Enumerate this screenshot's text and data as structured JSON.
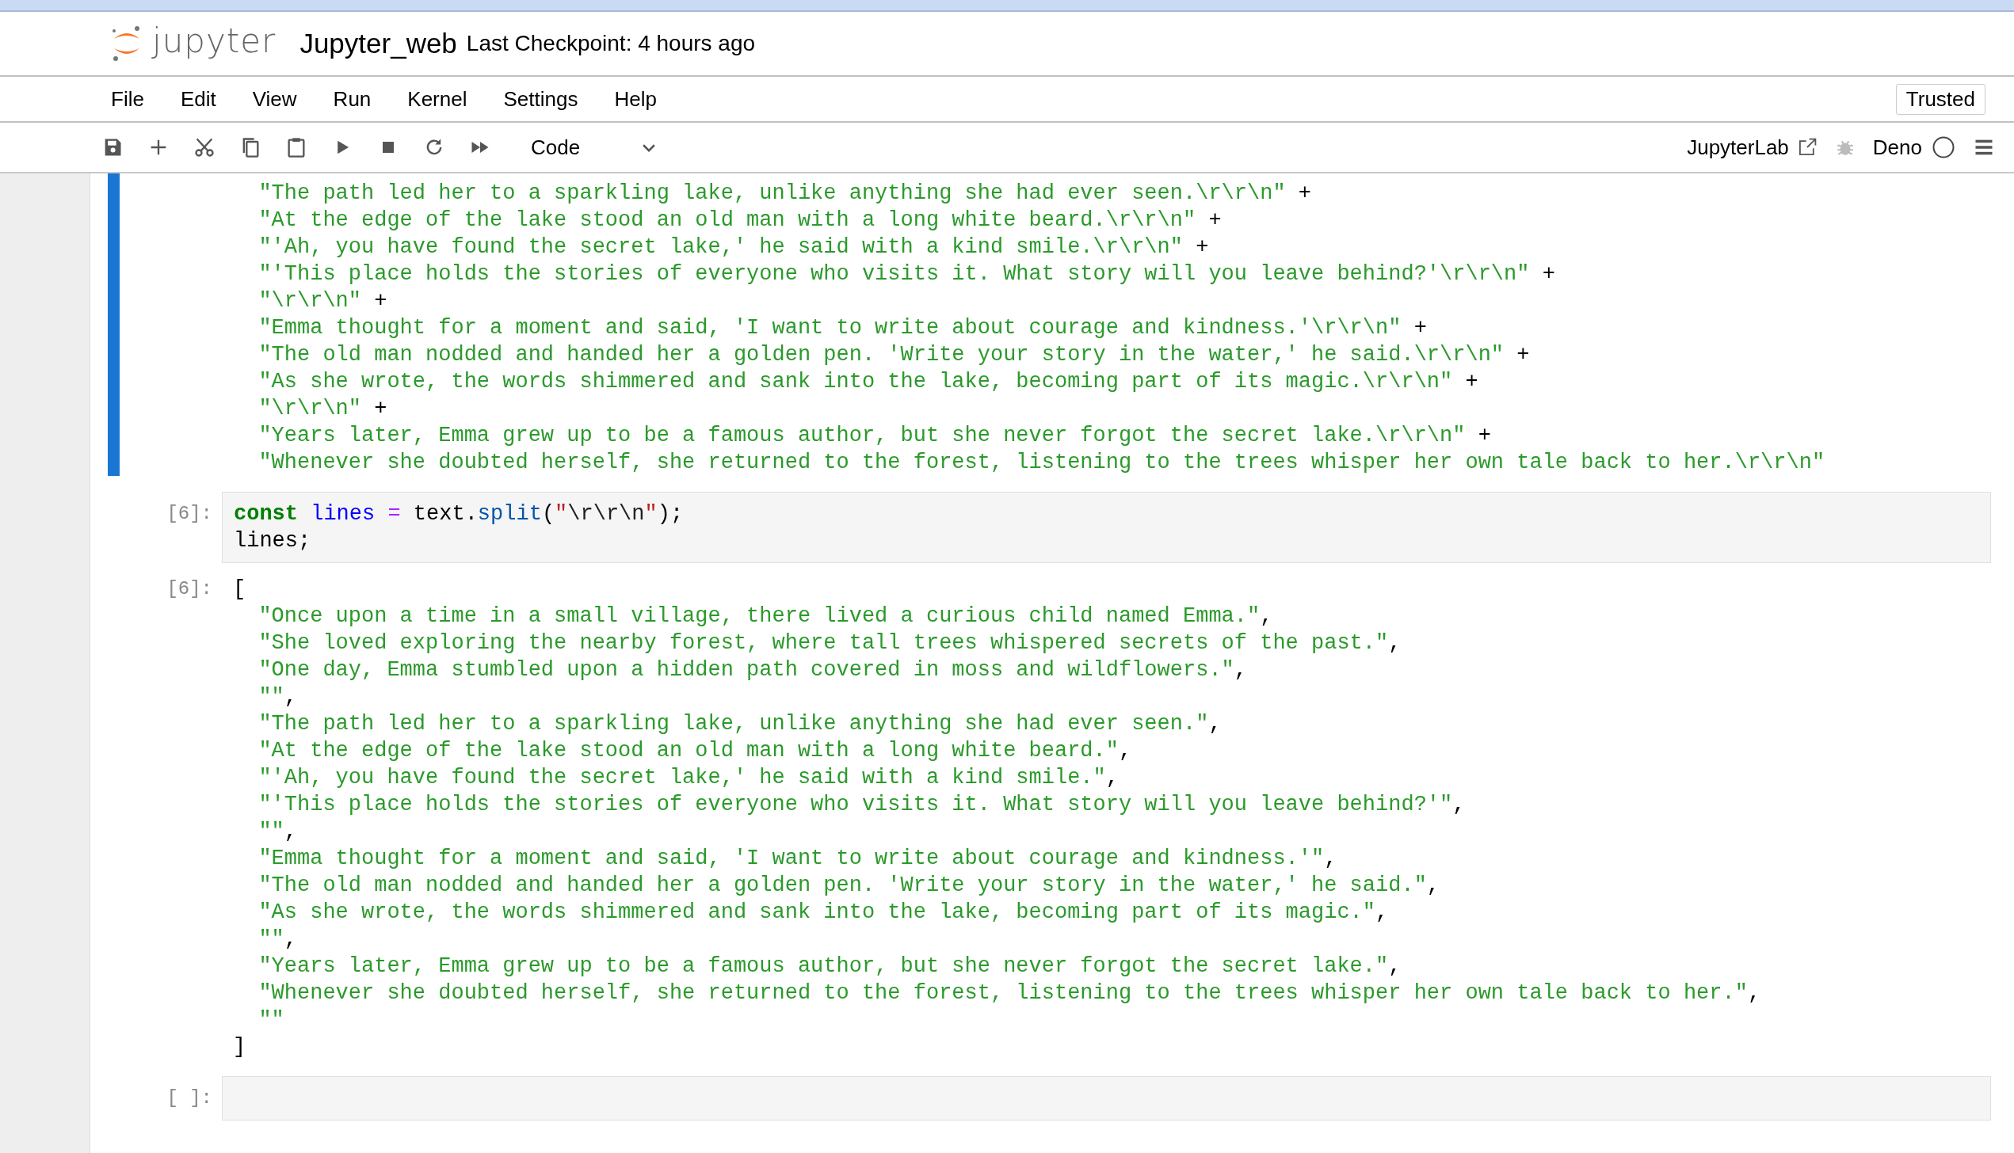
{
  "header": {
    "logo_text": "jupyter",
    "title": "Jupyter_web",
    "checkpoint": "Last Checkpoint: 4 hours ago"
  },
  "menu": [
    "File",
    "Edit",
    "View",
    "Run",
    "Kernel",
    "Settings",
    "Help"
  ],
  "trusted": "Trusted",
  "toolbar": {
    "cell_type": "Code",
    "jupyterlab_link": "JupyterLab",
    "kernel": "Deno"
  },
  "cells": [
    {
      "selected": true,
      "input": [
        [
          {
            "kind": "string",
            "text": "\"The path led her to a sparkling lake, unlike anything she had ever seen.\\r\\r\\n\""
          },
          {
            "kind": "plain",
            "text": " +"
          }
        ],
        [
          {
            "kind": "string",
            "text": "\"At the edge of the lake stood an old man with a long white beard.\\r\\r\\n\""
          },
          {
            "kind": "plain",
            "text": " +"
          }
        ],
        [
          {
            "kind": "string",
            "text": "\"'Ah, you have found the secret lake,' he said with a kind smile.\\r\\r\\n\""
          },
          {
            "kind": "plain",
            "text": " +"
          }
        ],
        [
          {
            "kind": "string",
            "text": "\"'This place holds the stories of everyone who visits it. What story will you leave behind?'\\r\\r\\n\""
          },
          {
            "kind": "plain",
            "text": " +"
          }
        ],
        [
          {
            "kind": "string",
            "text": "\"\\r\\r\\n\""
          },
          {
            "kind": "plain",
            "text": " +"
          }
        ],
        [
          {
            "kind": "string",
            "text": "\"Emma thought for a moment and said, 'I want to write about courage and kindness.'\\r\\r\\n\""
          },
          {
            "kind": "plain",
            "text": " +"
          }
        ],
        [
          {
            "kind": "string",
            "text": "\"The old man nodded and handed her a golden pen. 'Write your story in the water,' he said.\\r\\r\\n\""
          },
          {
            "kind": "plain",
            "text": " +"
          }
        ],
        [
          {
            "kind": "string",
            "text": "\"As she wrote, the words shimmered and sank into the lake, becoming part of its magic.\\r\\r\\n\""
          },
          {
            "kind": "plain",
            "text": " +"
          }
        ],
        [
          {
            "kind": "string",
            "text": "\"\\r\\r\\n\""
          },
          {
            "kind": "plain",
            "text": " +"
          }
        ],
        [
          {
            "kind": "string",
            "text": "\"Years later, Emma grew up to be a famous author, but she never forgot the secret lake.\\r\\r\\n\""
          },
          {
            "kind": "plain",
            "text": " +"
          }
        ],
        [
          {
            "kind": "string",
            "text": "\"Whenever she doubted herself, she returned to the forest, listening to the trees whisper her own tale back to her.\\r\\r\\n\""
          }
        ]
      ],
      "indented": true
    },
    {
      "selected": false,
      "prompt": "[6]:",
      "indented": false,
      "input": [
        [
          {
            "kind": "keyword",
            "text": "const"
          },
          {
            "kind": "variable",
            "text": " lines "
          },
          {
            "kind": "operator",
            "text": "="
          },
          {
            "kind": "plain",
            "text": " text."
          },
          {
            "kind": "property",
            "text": "split"
          },
          {
            "kind": "plain",
            "text": "("
          },
          {
            "kind": "quote",
            "text": "\""
          },
          {
            "kind": "escape",
            "text": "\\r\\r\\n"
          },
          {
            "kind": "quote",
            "text": "\""
          },
          {
            "kind": "plain",
            "text": ");"
          }
        ],
        [
          {
            "kind": "plain",
            "text": "lines;"
          }
        ]
      ],
      "output": {
        "prompt": "[6]:",
        "open": "[",
        "close": "]",
        "items": [
          "\"Once upon a time in a small village, there lived a curious child named Emma.\"",
          "\"She loved exploring the nearby forest, where tall trees whispered secrets of the past.\"",
          "\"One day, Emma stumbled upon a hidden path covered in moss and wildflowers.\"",
          "\"\"",
          "\"The path led her to a sparkling lake, unlike anything she had ever seen.\"",
          "\"At the edge of the lake stood an old man with a long white beard.\"",
          "\"'Ah, you have found the secret lake,' he said with a kind smile.\"",
          "\"'This place holds the stories of everyone who visits it. What story will you leave behind?'\"",
          "\"\"",
          "\"Emma thought for a moment and said, 'I want to write about courage and kindness.'\"",
          "\"The old man nodded and handed her a golden pen. 'Write your story in the water,' he said.\"",
          "\"As she wrote, the words shimmered and sank into the lake, becoming part of its magic.\"",
          "\"\"",
          "\"Years later, Emma grew up to be a famous author, but she never forgot the secret lake.\"",
          "\"Whenever she doubted herself, she returned to the forest, listening to the trees whisper her own tale back to her.\"",
          "\"\""
        ],
        "separator": ","
      }
    },
    {
      "selected": false,
      "prompt": "[ ]:"
    }
  ]
}
